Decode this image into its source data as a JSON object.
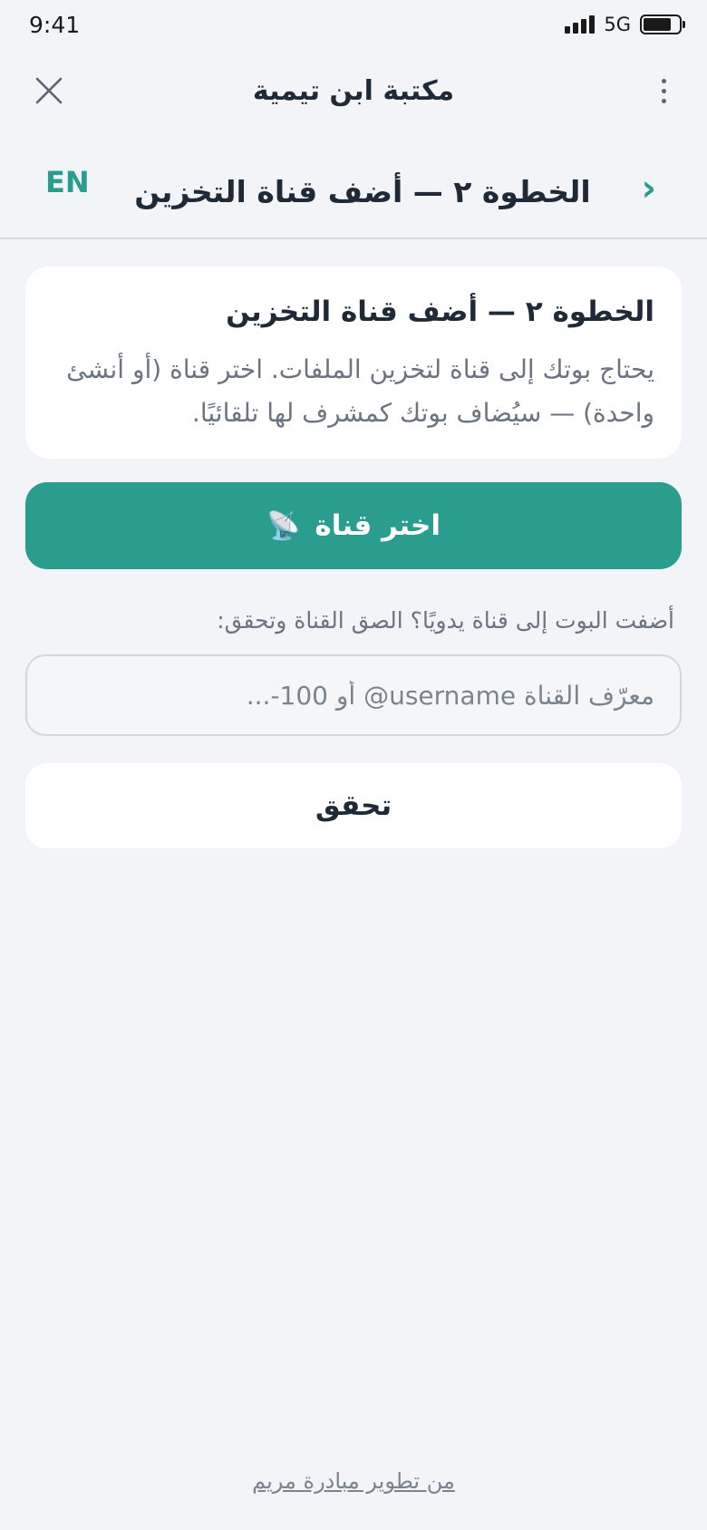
{
  "status_bar": {
    "time": "9:41",
    "network": "5G",
    "battery_level": 0.8
  },
  "header": {
    "title": "مكتبة ابن تيمية",
    "close_icon": "close-icon",
    "more_icon": "more-vertical-icon"
  },
  "step_bar": {
    "title": "الخطوة ٢ — أضف قناة التخزين",
    "lang_toggle": "EN",
    "back_icon": "chevron-icon"
  },
  "info_card": {
    "title": "الخطوة ٢ — أضف قناة التخزين",
    "body": "يحتاج بوتك إلى قناة لتخزين الملفات. اختر قناة (أو أنشئ واحدة) — سيُضاف بوتك كمشرف لها تلقائيًا."
  },
  "choose_channel": {
    "label": "اختر قناة",
    "icon": "📡"
  },
  "manual": {
    "label": "أضفت البوت إلى قناة يدويًا؟ الصق القناة وتحقق:",
    "input_value": "",
    "input_placeholder": "معرّف القناة ‎@username أو ‎-100..."
  },
  "verify_button": {
    "label": "تحقق"
  },
  "footer": {
    "credit": "من تطوير مبادرة مريم"
  },
  "colors": {
    "accent": "#2a9d8f",
    "background": "#f2f4f7",
    "card": "#ffffff"
  }
}
